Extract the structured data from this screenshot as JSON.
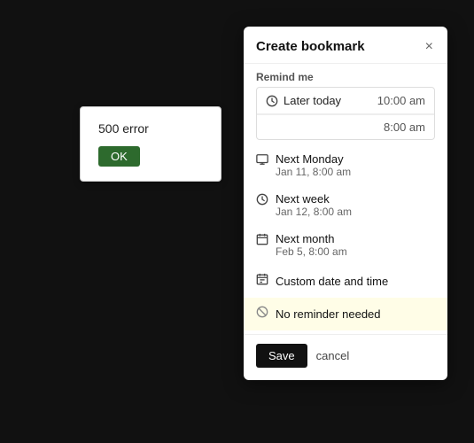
{
  "background": "#111111",
  "error_dialog": {
    "message": "500 error",
    "ok_label": "OK"
  },
  "bookmark_panel": {
    "title": "Create bookmark",
    "close_label": "×",
    "remind_me_label": "Remind me",
    "dropdown": {
      "item1_label": "Later today",
      "item1_time": "10:00 am",
      "item2_time": "8:00 am"
    },
    "menu_items": [
      {
        "id": "next-monday",
        "icon": "monitor",
        "label": "Next Monday",
        "sublabel": "Jan 11, 8:00 am"
      },
      {
        "id": "next-week",
        "icon": "clock",
        "label": "Next week",
        "sublabel": "Jan 12, 8:00 am"
      },
      {
        "id": "next-month",
        "icon": "calendar",
        "label": "Next month",
        "sublabel": "Feb 5, 8:00 am"
      },
      {
        "id": "custom",
        "icon": "calendar2",
        "label": "Custom date and time",
        "sublabel": ""
      }
    ],
    "no_reminder_label": "No reminder needed",
    "save_label": "Save",
    "cancel_label": "cancel"
  }
}
